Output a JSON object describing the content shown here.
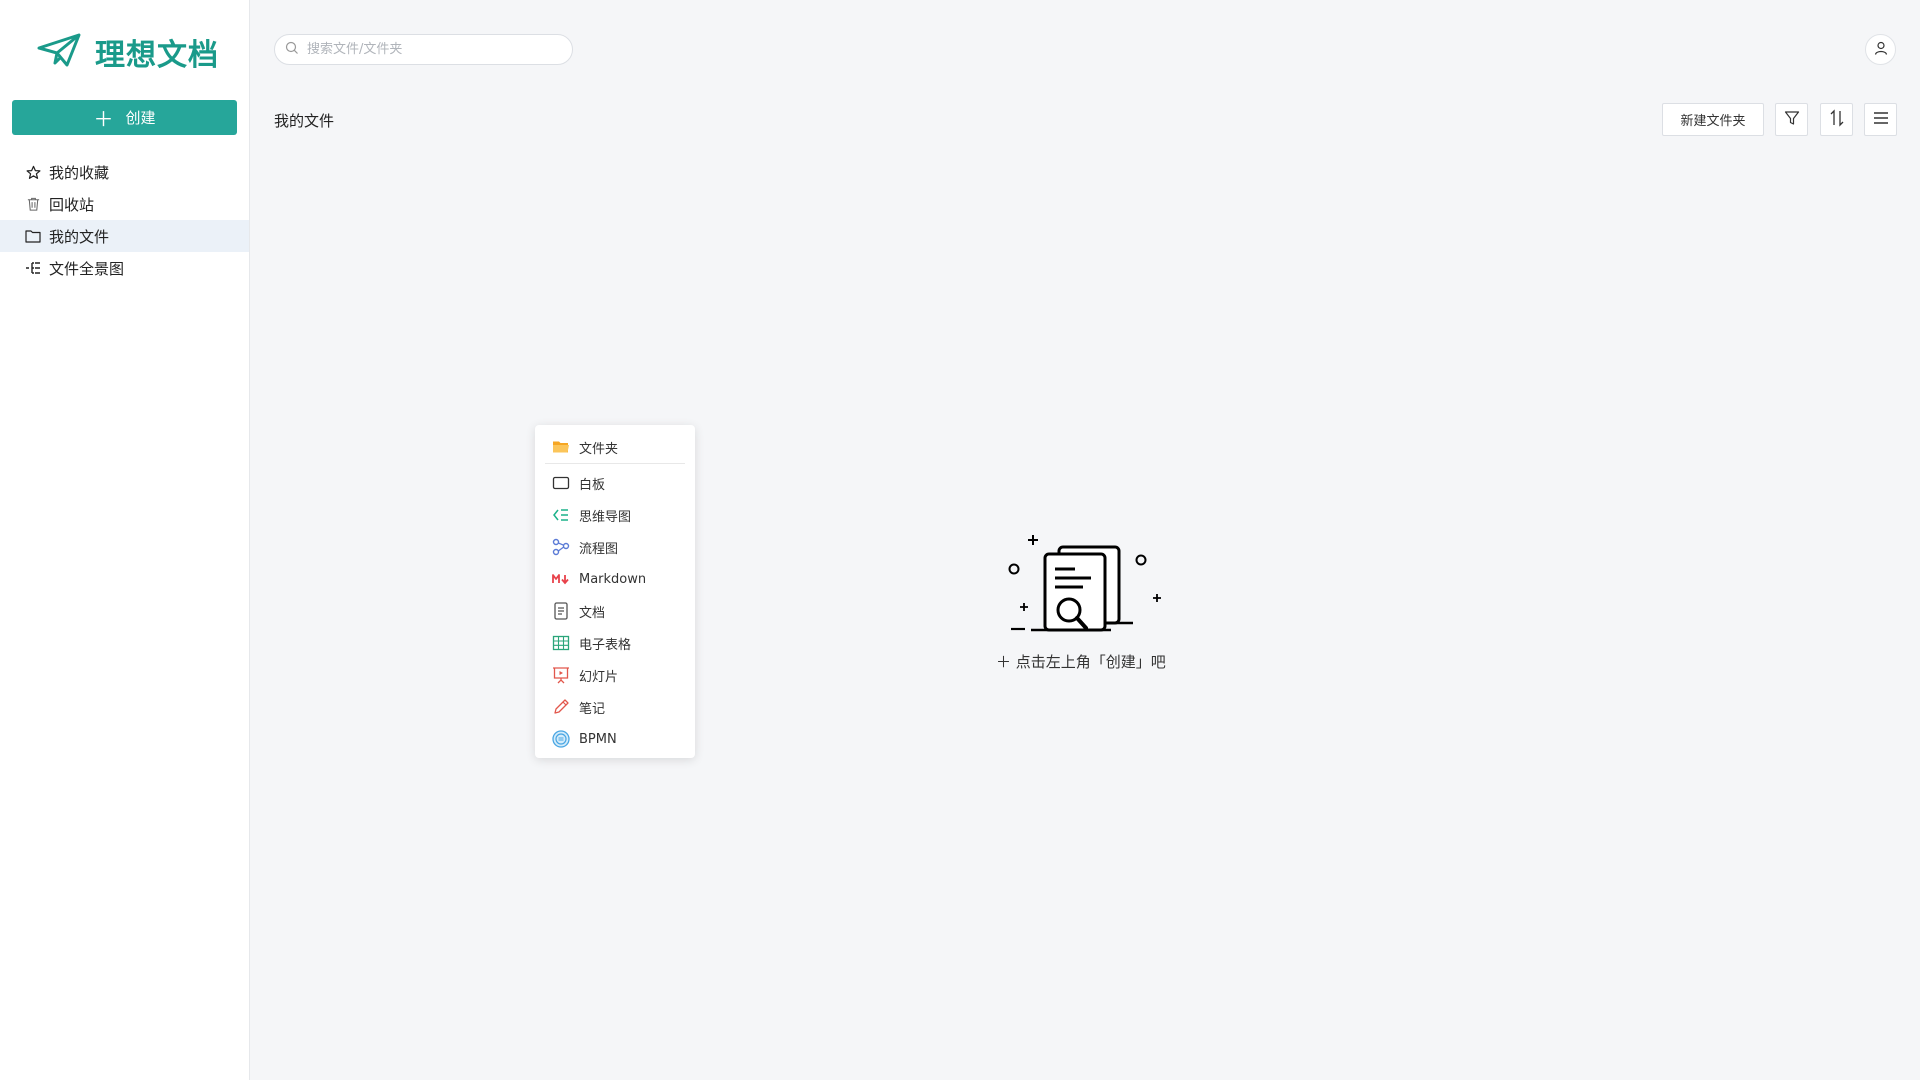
{
  "brand": {
    "name": "理想文档",
    "color": "#1a9a8a"
  },
  "sidebar": {
    "create_label": "创建",
    "items": [
      {
        "label": "我的收藏",
        "icon": "star-icon"
      },
      {
        "label": "回收站",
        "icon": "trash-icon"
      },
      {
        "label": "我的文件",
        "icon": "folder-icon",
        "active": true
      },
      {
        "label": "文件全景图",
        "icon": "tree-icon"
      }
    ]
  },
  "header": {
    "search_placeholder": "搜索文件/文件夹"
  },
  "main": {
    "title": "我的文件",
    "toolbar": {
      "new_folder_label": "新建文件夹"
    },
    "empty_text": "点击左上角「创建」吧"
  },
  "dropdown": {
    "items": [
      {
        "label": "文件夹",
        "icon": "folder-open-icon"
      },
      {
        "label": "白板",
        "icon": "whiteboard-icon"
      },
      {
        "label": "思维导图",
        "icon": "mindmap-icon"
      },
      {
        "label": "流程图",
        "icon": "flowchart-icon"
      },
      {
        "label": "Markdown",
        "icon": "markdown-icon"
      },
      {
        "label": "文档",
        "icon": "document-icon"
      },
      {
        "label": "电子表格",
        "icon": "spreadsheet-icon"
      },
      {
        "label": "幻灯片",
        "icon": "slides-icon"
      },
      {
        "label": "笔记",
        "icon": "pen-icon"
      },
      {
        "label": "BPMN",
        "icon": "bpmn-icon"
      }
    ]
  },
  "colors": {
    "accent": "#26a69a",
    "active_bg": "#ebf1f8"
  }
}
